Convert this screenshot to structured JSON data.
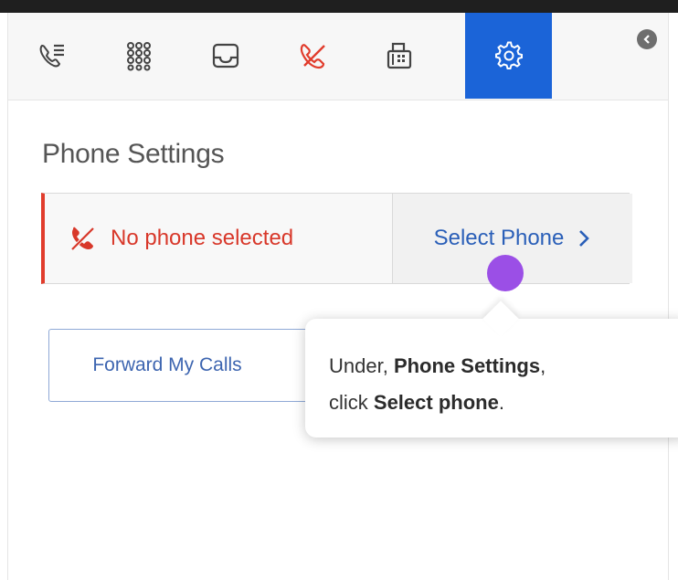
{
  "toolbar": {
    "items": [
      {
        "icon": "call-history-icon",
        "active": false
      },
      {
        "icon": "dialpad-icon",
        "active": false
      },
      {
        "icon": "inbox-icon",
        "active": false
      },
      {
        "icon": "missed-call-icon",
        "active": false
      },
      {
        "icon": "fax-icon",
        "active": false
      },
      {
        "icon": "gear-icon",
        "active": true
      }
    ],
    "collapse_icon": "chevron-left-icon"
  },
  "colors": {
    "active_tab": "#1b64d8",
    "alert_red": "#e13c2c",
    "link_blue": "#2a5fb8",
    "click_marker": "#9b4fe6"
  },
  "phone_settings": {
    "title": "Phone Settings",
    "status_text": "No phone selected",
    "select_label": "Select Phone"
  },
  "forward": {
    "label": "Forward My Calls"
  },
  "tooltip": {
    "part1": "Under, ",
    "bold1": "Phone Settings",
    "part2": ",",
    "part3": "click ",
    "bold2": "Select phone",
    "part4": "."
  }
}
